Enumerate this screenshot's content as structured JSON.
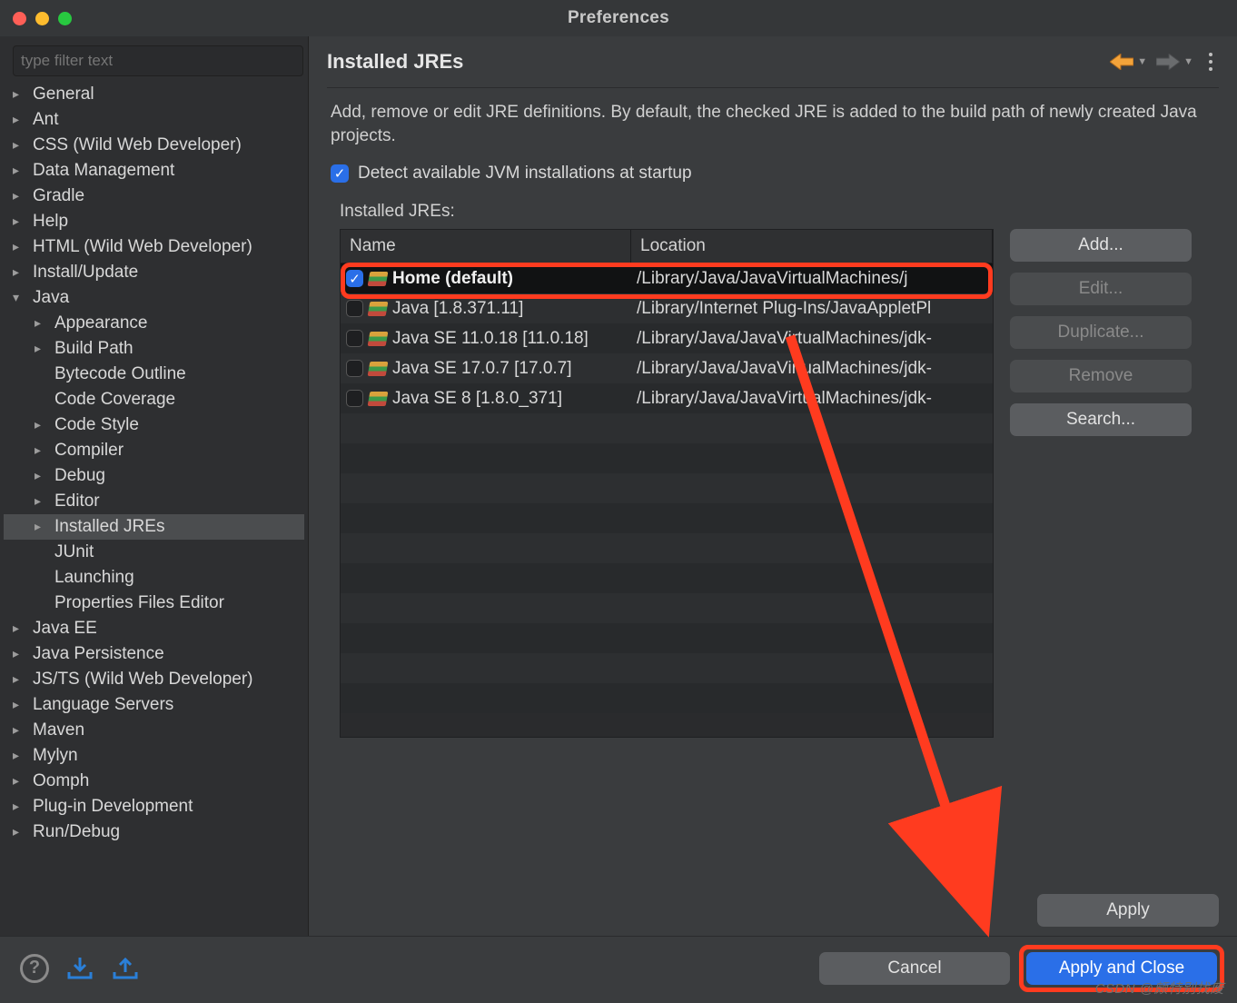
{
  "window": {
    "title": "Preferences"
  },
  "filter": {
    "placeholder": "type filter text"
  },
  "tree": [
    {
      "label": "General",
      "indent": 0,
      "expand": "right"
    },
    {
      "label": "Ant",
      "indent": 0,
      "expand": "right"
    },
    {
      "label": "CSS (Wild Web Developer)",
      "indent": 0,
      "expand": "right"
    },
    {
      "label": "Data Management",
      "indent": 0,
      "expand": "right"
    },
    {
      "label": "Gradle",
      "indent": 0,
      "expand": "right"
    },
    {
      "label": "Help",
      "indent": 0,
      "expand": "right"
    },
    {
      "label": "HTML (Wild Web Developer)",
      "indent": 0,
      "expand": "right"
    },
    {
      "label": "Install/Update",
      "indent": 0,
      "expand": "right"
    },
    {
      "label": "Java",
      "indent": 0,
      "expand": "down"
    },
    {
      "label": "Appearance",
      "indent": 1,
      "expand": "right"
    },
    {
      "label": "Build Path",
      "indent": 1,
      "expand": "right"
    },
    {
      "label": "Bytecode Outline",
      "indent": 1,
      "expand": "none"
    },
    {
      "label": "Code Coverage",
      "indent": 1,
      "expand": "none"
    },
    {
      "label": "Code Style",
      "indent": 1,
      "expand": "right"
    },
    {
      "label": "Compiler",
      "indent": 1,
      "expand": "right"
    },
    {
      "label": "Debug",
      "indent": 1,
      "expand": "right"
    },
    {
      "label": "Editor",
      "indent": 1,
      "expand": "right"
    },
    {
      "label": "Installed JREs",
      "indent": 1,
      "expand": "right",
      "selected": true
    },
    {
      "label": "JUnit",
      "indent": 1,
      "expand": "none"
    },
    {
      "label": "Launching",
      "indent": 1,
      "expand": "none"
    },
    {
      "label": "Properties Files Editor",
      "indent": 1,
      "expand": "none"
    },
    {
      "label": "Java EE",
      "indent": 0,
      "expand": "right"
    },
    {
      "label": "Java Persistence",
      "indent": 0,
      "expand": "right"
    },
    {
      "label": "JS/TS (Wild Web Developer)",
      "indent": 0,
      "expand": "right"
    },
    {
      "label": "Language Servers",
      "indent": 0,
      "expand": "right"
    },
    {
      "label": "Maven",
      "indent": 0,
      "expand": "right"
    },
    {
      "label": "Mylyn",
      "indent": 0,
      "expand": "right"
    },
    {
      "label": "Oomph",
      "indent": 0,
      "expand": "right"
    },
    {
      "label": "Plug-in Development",
      "indent": 0,
      "expand": "right"
    },
    {
      "label": "Run/Debug",
      "indent": 0,
      "expand": "right"
    }
  ],
  "page": {
    "title": "Installed JREs",
    "description": "Add, remove or edit JRE definitions. By default, the checked JRE is added to the build path of newly created Java projects.",
    "detect_label": "Detect available JVM installations at startup",
    "detect_checked": true,
    "table_label": "Installed JREs:",
    "columns": {
      "name": "Name",
      "location": "Location"
    },
    "rows": [
      {
        "checked": true,
        "name": "Home (default)",
        "bold": true,
        "location": "/Library/Java/JavaVirtualMachines/j"
      },
      {
        "checked": false,
        "name": "Java [1.8.371.11]",
        "location": "/Library/Internet Plug-Ins/JavaAppletPl"
      },
      {
        "checked": false,
        "name": "Java SE 11.0.18 [11.0.18]",
        "location": "/Library/Java/JavaVirtualMachines/jdk-"
      },
      {
        "checked": false,
        "name": "Java SE 17.0.7 [17.0.7]",
        "location": "/Library/Java/JavaVirtualMachines/jdk-"
      },
      {
        "checked": false,
        "name": "Java SE 8 [1.8.0_371]",
        "location": "/Library/Java/JavaVirtualMachines/jdk-"
      }
    ],
    "buttons": {
      "add": "Add...",
      "edit": "Edit...",
      "duplicate": "Duplicate...",
      "remove": "Remove",
      "search": "Search...",
      "apply": "Apply"
    }
  },
  "footer": {
    "cancel": "Cancel",
    "apply_close": "Apply and Close"
  },
  "watermark": "CSDN @颇特别找废"
}
